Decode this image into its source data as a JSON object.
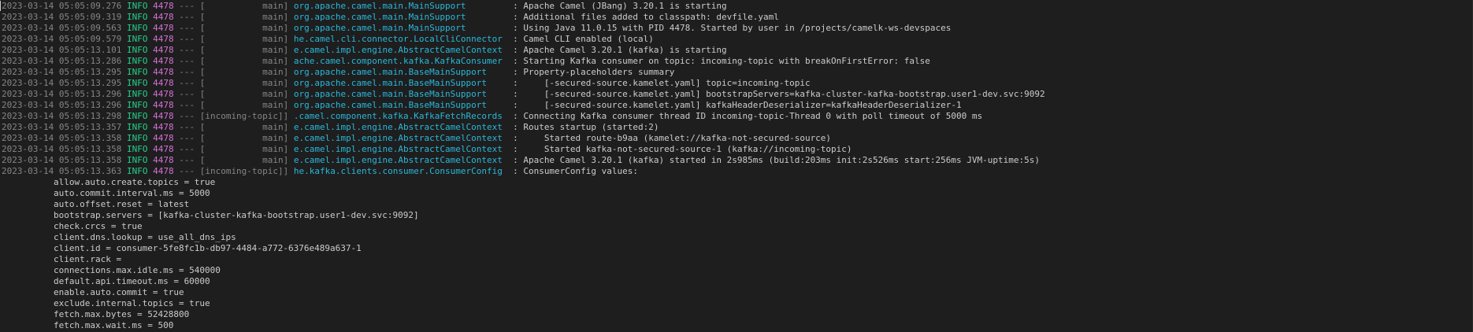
{
  "log_lines": [
    {
      "ts": "2023-03-14 05:05:09.276",
      "level": "INFO",
      "pid": "4478",
      "sep": "---",
      "thread": "[           main]",
      "logger": "org.apache.camel.main.MainSupport        ",
      "msg": ": Apache Camel (JBang) 3.20.1 is starting"
    },
    {
      "ts": "2023-03-14 05:05:09.319",
      "level": "INFO",
      "pid": "4478",
      "sep": "---",
      "thread": "[           main]",
      "logger": "org.apache.camel.main.MainSupport        ",
      "msg": ": Additional files added to classpath: devfile.yaml"
    },
    {
      "ts": "2023-03-14 05:05:09.563",
      "level": "INFO",
      "pid": "4478",
      "sep": "---",
      "thread": "[           main]",
      "logger": "org.apache.camel.main.MainSupport        ",
      "msg": ": Using Java 11.0.15 with PID 4478. Started by user in /projects/camelk-ws-devspaces"
    },
    {
      "ts": "2023-03-14 05:05:09.579",
      "level": "INFO",
      "pid": "4478",
      "sep": "---",
      "thread": "[           main]",
      "logger": "he.camel.cli.connector.LocalCliConnector ",
      "msg": ": Camel CLI enabled (local)"
    },
    {
      "ts": "2023-03-14 05:05:13.101",
      "level": "INFO",
      "pid": "4478",
      "sep": "---",
      "thread": "[           main]",
      "logger": "e.camel.impl.engine.AbstractCamelContext ",
      "msg": ": Apache Camel 3.20.1 (kafka) is starting"
    },
    {
      "ts": "2023-03-14 05:05:13.286",
      "level": "INFO",
      "pid": "4478",
      "sep": "---",
      "thread": "[           main]",
      "logger": "ache.camel.component.kafka.KafkaConsumer ",
      "msg": ": Starting Kafka consumer on topic: incoming-topic with breakOnFirstError: false"
    },
    {
      "ts": "2023-03-14 05:05:13.295",
      "level": "INFO",
      "pid": "4478",
      "sep": "---",
      "thread": "[           main]",
      "logger": "org.apache.camel.main.BaseMainSupport    ",
      "msg": ": Property-placeholders summary"
    },
    {
      "ts": "2023-03-14 05:05:13.295",
      "level": "INFO",
      "pid": "4478",
      "sep": "---",
      "thread": "[           main]",
      "logger": "org.apache.camel.main.BaseMainSupport    ",
      "msg": ":     [-secured-source.kamelet.yaml] topic=incoming-topic"
    },
    {
      "ts": "2023-03-14 05:05:13.296",
      "level": "INFO",
      "pid": "4478",
      "sep": "---",
      "thread": "[           main]",
      "logger": "org.apache.camel.main.BaseMainSupport    ",
      "msg": ":     [-secured-source.kamelet.yaml] bootstrapServers=kafka-cluster-kafka-bootstrap.user1-dev.svc:9092"
    },
    {
      "ts": "2023-03-14 05:05:13.296",
      "level": "INFO",
      "pid": "4478",
      "sep": "---",
      "thread": "[           main]",
      "logger": "org.apache.camel.main.BaseMainSupport    ",
      "msg": ":     [-secured-source.kamelet.yaml] kafkaHeaderDeserializer=kafkaHeaderDeserializer-1"
    },
    {
      "ts": "2023-03-14 05:05:13.298",
      "level": "INFO",
      "pid": "4478",
      "sep": "---",
      "thread": "[incoming-topic]]",
      "logger": ".camel.component.kafka.KafkaFetchRecords ",
      "msg": ": Connecting Kafka consumer thread ID incoming-topic-Thread 0 with poll timeout of 5000 ms"
    },
    {
      "ts": "2023-03-14 05:05:13.357",
      "level": "INFO",
      "pid": "4478",
      "sep": "---",
      "thread": "[           main]",
      "logger": "e.camel.impl.engine.AbstractCamelContext ",
      "msg": ": Routes startup (started:2)"
    },
    {
      "ts": "2023-03-14 05:05:13.358",
      "level": "INFO",
      "pid": "4478",
      "sep": "---",
      "thread": "[           main]",
      "logger": "e.camel.impl.engine.AbstractCamelContext ",
      "msg": ":     Started route-b9aa (kamelet://kafka-not-secured-source)"
    },
    {
      "ts": "2023-03-14 05:05:13.358",
      "level": "INFO",
      "pid": "4478",
      "sep": "---",
      "thread": "[           main]",
      "logger": "e.camel.impl.engine.AbstractCamelContext ",
      "msg": ":     Started kafka-not-secured-source-1 (kafka://incoming-topic)"
    },
    {
      "ts": "2023-03-14 05:05:13.358",
      "level": "INFO",
      "pid": "4478",
      "sep": "---",
      "thread": "[           main]",
      "logger": "e.camel.impl.engine.AbstractCamelContext ",
      "msg": ": Apache Camel 3.20.1 (kafka) started in 2s985ms (build:203ms init:2s526ms start:256ms JVM-uptime:5s)"
    },
    {
      "ts": "2023-03-14 05:05:13.363",
      "level": "INFO",
      "pid": "4478",
      "sep": "---",
      "thread": "[incoming-topic]]",
      "logger": "he.kafka.clients.consumer.ConsumerConfig ",
      "msg": ": ConsumerConfig values:"
    }
  ],
  "config_lines": [
    "allow.auto.create.topics = true",
    "auto.commit.interval.ms = 5000",
    "auto.offset.reset = latest",
    "bootstrap.servers = [kafka-cluster-kafka-bootstrap.user1-dev.svc:9092]",
    "check.crcs = true",
    "client.dns.lookup = use_all_dns_ips",
    "client.id = consumer-5fe8fc1b-db97-4484-a772-6376e489a637-1",
    "client.rack =",
    "connections.max.idle.ms = 540000",
    "default.api.timeout.ms = 60000",
    "enable.auto.commit = true",
    "exclude.internal.topics = true",
    "fetch.max.bytes = 52428800",
    "fetch.max.wait.ms = 500"
  ]
}
